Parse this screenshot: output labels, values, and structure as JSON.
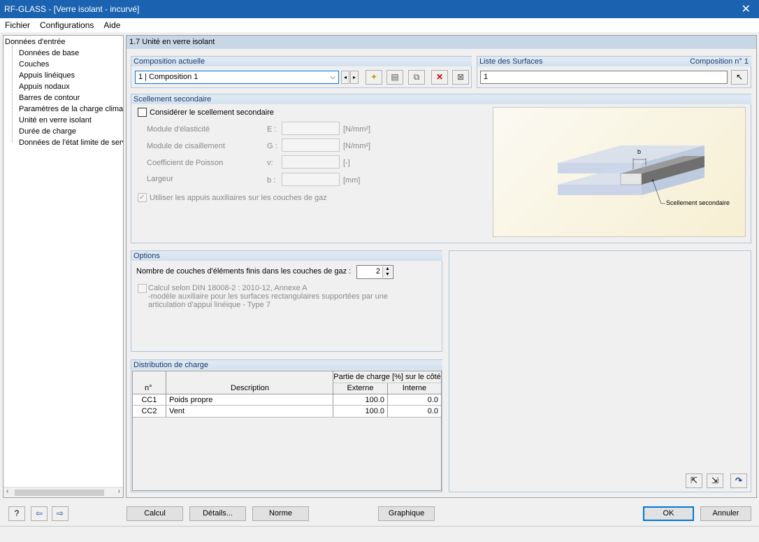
{
  "window": {
    "title": "RF-GLASS - [Verre isolant - incurvé]"
  },
  "menu": [
    "Fichier",
    "Configurations",
    "Aide"
  ],
  "nav": {
    "root": "Données d'entrée",
    "items": [
      "Données de base",
      "Couches",
      "Appuis linéiques",
      "Appuis nodaux",
      "Barres de contour",
      "Paramètres de la charge climati",
      "Unité en verre isolant",
      "Durée de charge",
      "Données de l'état limite de serv"
    ]
  },
  "section": {
    "title": "1.7 Unité en verre isolant"
  },
  "composition": {
    "header": "Composition actuelle",
    "value": "1 | Composition 1"
  },
  "surfaces": {
    "header": "Liste des Surfaces",
    "composition_label": "Composition n° 1",
    "value": "1"
  },
  "sealing": {
    "header": "Scellement secondaire",
    "checkbox": "Considérer le scellement secondaire",
    "rows": [
      {
        "label": "Module d'élasticité",
        "sym": "E :",
        "unit": "[N/mm²]"
      },
      {
        "label": "Module de cisaillement",
        "sym": "G :",
        "unit": "[N/mm²]"
      },
      {
        "label": "Coefficient de Poisson",
        "sym": "ν:",
        "unit": "[-]"
      },
      {
        "label": "Largeur",
        "sym": "b :",
        "unit": "[mm]"
      }
    ],
    "aux_checkbox": "Utiliser les appuis auxiliaires sur les couches de gaz",
    "diagram_label": "Scellement secondaire",
    "diagram_dim": "b"
  },
  "options": {
    "header": "Options",
    "layers_label": "Nombre de couches d'éléments finis dans les couches de gaz :",
    "layers_value": "2",
    "din_line1": "Calcul selon DIN 18008-2 : 2010-12, Annexe A",
    "din_line2": "-modèle auxiliaire pour les surfaces rectangulaires supportées par une",
    "din_line3": "articulation d'appui linéique - Type 7"
  },
  "load": {
    "header": "Distribution de charge",
    "col_n": "n°",
    "col_desc": "Description",
    "col_group": "Partie de charge [%] sur le côté",
    "col_ext": "Externe",
    "col_int": "Interne",
    "rows": [
      {
        "n": "CC1",
        "desc": "Poids propre",
        "ext": "100.0",
        "int": "0.0"
      },
      {
        "n": "CC2",
        "desc": "Vent",
        "ext": "100.0",
        "int": "0.0"
      }
    ]
  },
  "buttons": {
    "calc": "Calcul",
    "details": "Détails...",
    "norm": "Norme",
    "graphic": "Graphique",
    "ok": "OK",
    "cancel": "Annuler"
  }
}
